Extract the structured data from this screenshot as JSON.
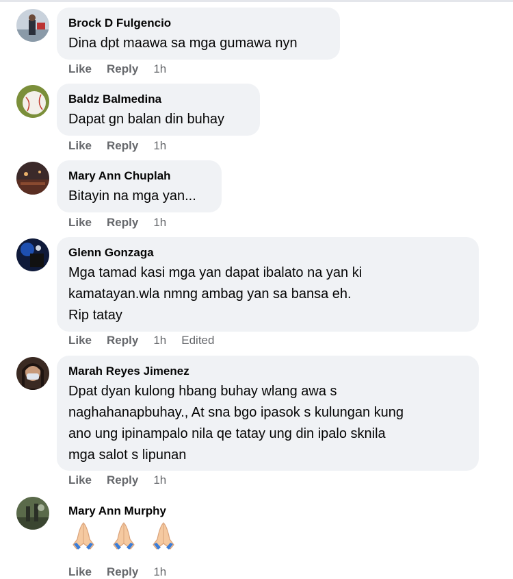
{
  "actions": {
    "like": "Like",
    "reply": "Reply",
    "edited": "Edited"
  },
  "comments": [
    {
      "author": "Brock D Fulgencio",
      "text": "Dina dpt maawa sa mga gumawa nyn",
      "time": "1h"
    },
    {
      "author": "Baldz Balmedina",
      "text": "Dapat gn balan din buhay",
      "time": "1h"
    },
    {
      "author": "Mary Ann Chuplah",
      "text": "Bitayin na mga yan...",
      "time": "1h"
    },
    {
      "author": "Glenn Gonzaga",
      "lines": [
        "Mga tamad kasi mga yan dapat ibalato na yan ki",
        "kamatayan.wla nmng ambag yan sa bansa eh.",
        "Rip tatay"
      ],
      "time": "1h",
      "edited": true
    },
    {
      "author": "Marah Reyes Jimenez",
      "lines": [
        "Dpat dyan kulong hbang buhay wlang awa s",
        "naghahanapbuhay., At sna bgo ipasok s kulungan kung",
        "ano ung ipinampalo nila qe tatay ung din ipalo sknila",
        "mga salot s lipunan"
      ],
      "time": "1h"
    },
    {
      "author": "Mary Ann Murphy",
      "text": "🙏🙏🙏",
      "time": "1h"
    }
  ],
  "colors": {
    "bubble": "#f0f2f5",
    "meta": "#65676b",
    "text": "#050505"
  }
}
